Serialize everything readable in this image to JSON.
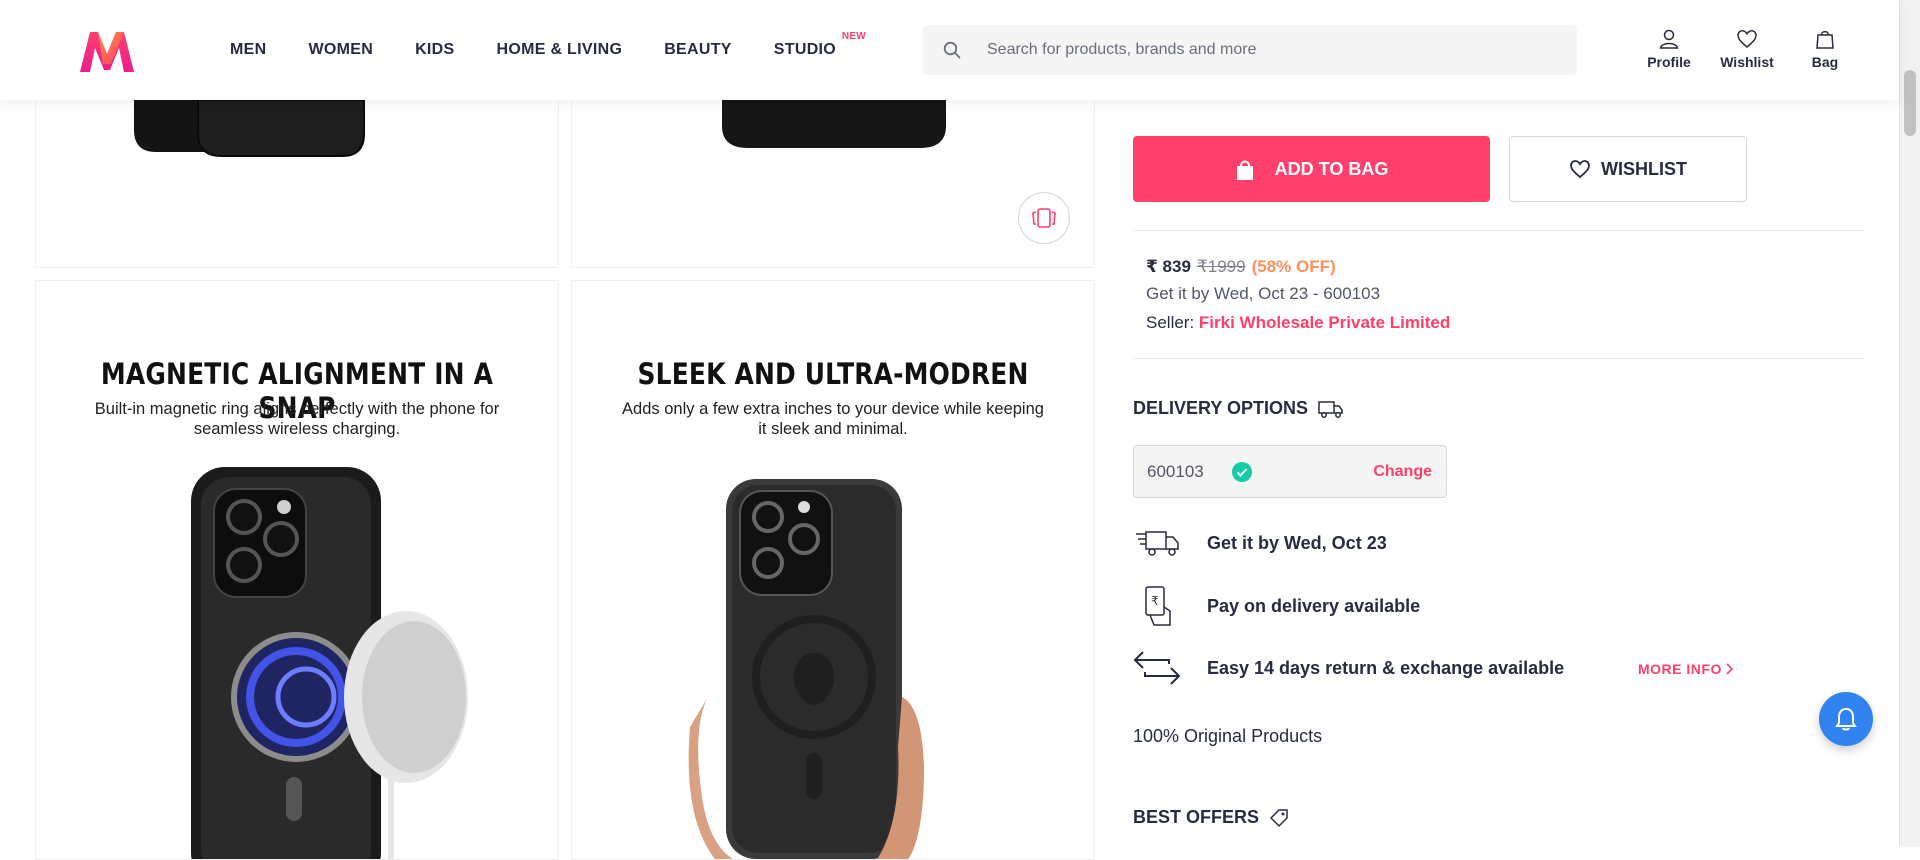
{
  "header": {
    "nav": [
      {
        "label": "MEN"
      },
      {
        "label": "WOMEN"
      },
      {
        "label": "KIDS"
      },
      {
        "label": "HOME & LIVING"
      },
      {
        "label": "BEAUTY"
      },
      {
        "label": "STUDIO",
        "badge": "NEW"
      }
    ],
    "search": {
      "placeholder": "Search for products, brands and more"
    },
    "actions": [
      {
        "label": "Profile",
        "icon": "profile-icon"
      },
      {
        "label": "Wishlist",
        "icon": "heart-icon"
      },
      {
        "label": "Bag",
        "icon": "bag-icon"
      }
    ]
  },
  "gallery": {
    "tiles": [
      {
        "title": "MAGNETIC ALIGNMENT IN A SNAP",
        "desc": "Built-in magnetic ring aligns perfectly with the phone for seamless wireless charging."
      },
      {
        "title": "SLEEK AND ULTRA-MODREN",
        "desc": "Adds only a few extra inches to your device while keeping it sleek and minimal."
      }
    ]
  },
  "product": {
    "add_to_bag_label": "ADD TO BAG",
    "wishlist_label": "WISHLIST",
    "price": "₹ 839",
    "mrp": "₹1999",
    "discount": "(58% OFF)",
    "delivery_line": "Get it by Wed, Oct 23 - 600103",
    "seller_prefix": "Seller: ",
    "seller_name": "Firki Wholesale Private Limited"
  },
  "delivery": {
    "title": "DELIVERY OPTIONS",
    "pincode": "600103",
    "change_label": "Change",
    "items": [
      {
        "text": "Get it by Wed, Oct 23",
        "icon": "delivery-truck-icon"
      },
      {
        "text": "Pay on delivery available",
        "icon": "cash-on-delivery-icon"
      },
      {
        "text": "Easy 14 days return & exchange available",
        "icon": "return-exchange-icon"
      }
    ],
    "more_info_label": "MORE INFO",
    "original_text": "100% Original Products"
  },
  "offers": {
    "title": "BEST OFFERS"
  },
  "colors": {
    "brand_pink": "#ff3f6c",
    "discount_orange": "#ff905a",
    "notify_blue": "#3183f0",
    "check_green": "#14cda8"
  }
}
